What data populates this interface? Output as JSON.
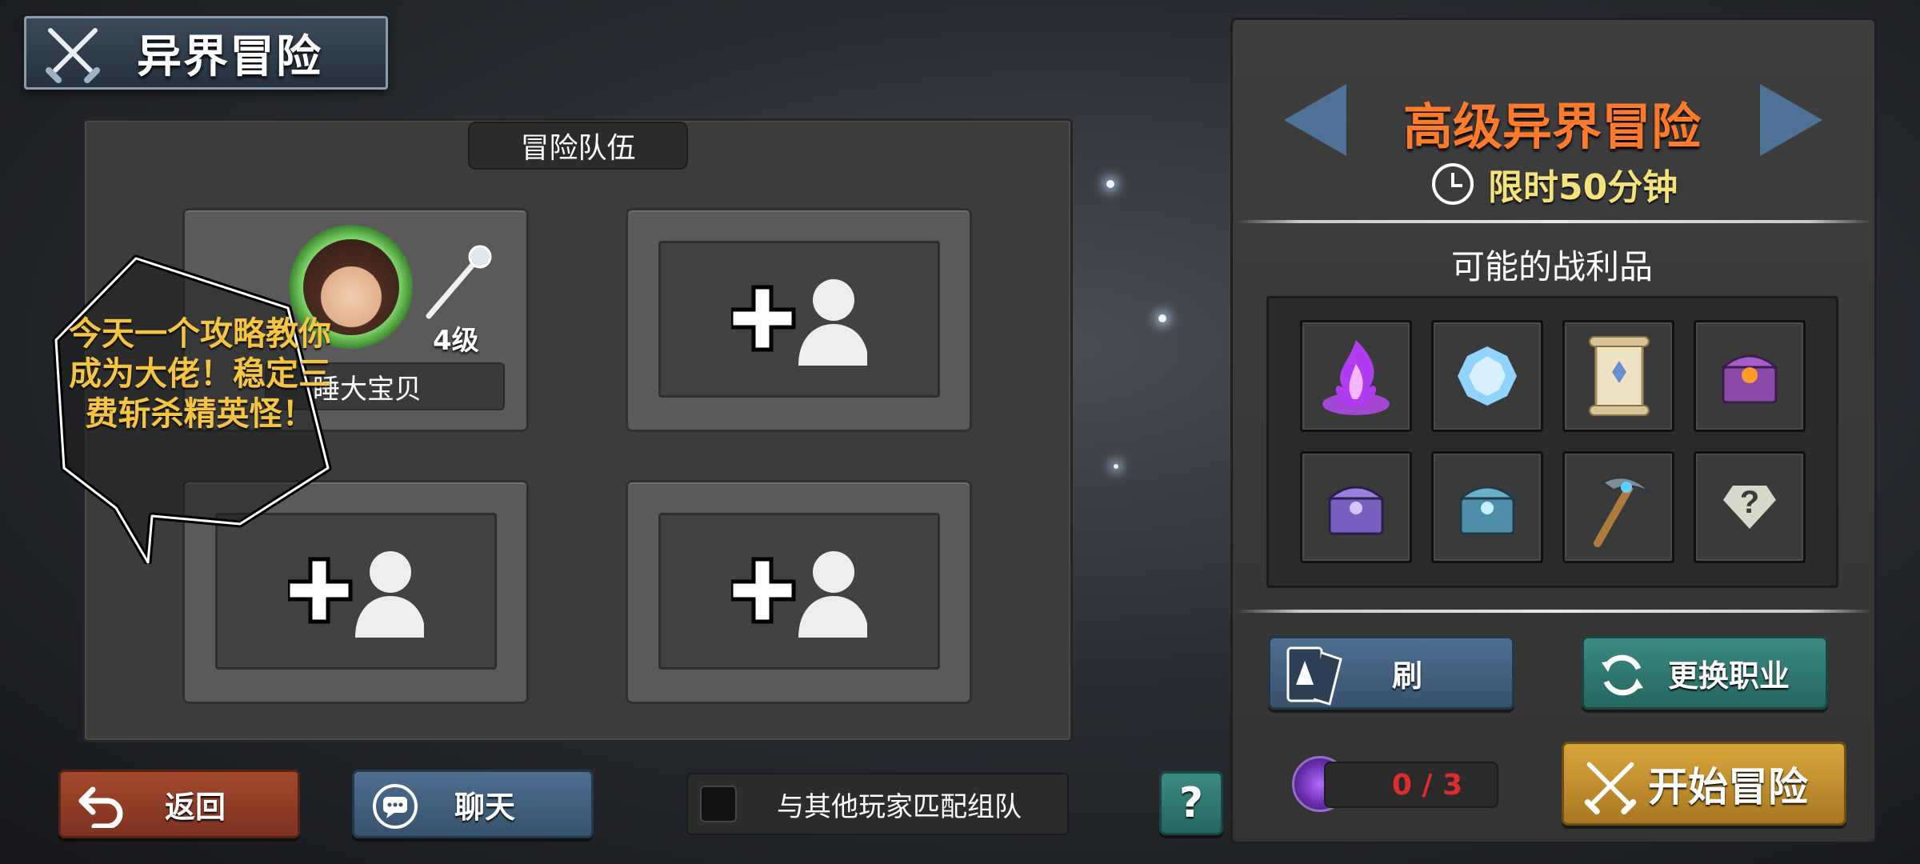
{
  "header": {
    "title": "异界冒险",
    "icon": "crossed-swords-icon"
  },
  "team": {
    "tab_label": "冒险队伍",
    "slots": [
      {
        "filled": true,
        "level": "4级",
        "name": "睡大宝贝",
        "weapon_icon": "staff-icon"
      },
      {
        "filled": false,
        "icon": "add-member-icon"
      },
      {
        "filled": false,
        "icon": "add-member-icon"
      },
      {
        "filled": false,
        "icon": "add-member-icon"
      }
    ]
  },
  "overlay": {
    "bubble_text": "今天一个攻略教你成为大佬！稳定三费斩杀精英怪！"
  },
  "bottom_bar": {
    "back_label": "返回",
    "chat_label": "聊天",
    "match_label": "与其他玩家匹配组队",
    "help_label": "?"
  },
  "mode": {
    "title": "高级异界冒险",
    "time_limit": "限时50分钟",
    "loot_title": "可能的战利品",
    "loot_items": [
      "purple-flame-icon",
      "ice-crystal-icon",
      "scroll-icon",
      "orange-chest-icon",
      "purple-chest-icon",
      "blue-chest-icon",
      "pickaxe-icon",
      "unknown-reward-icon"
    ]
  },
  "actions": {
    "refresh_label": "刷",
    "change_class_label": "更换职业",
    "counter": "0 / 3",
    "start_label": "开始冒险"
  },
  "colors": {
    "mode_title": "#ff7a2a",
    "time_limit": "#f5e27a",
    "counter": "#e02c2c",
    "bubble_text": "#f5c542",
    "start_button": "#d9a63c"
  }
}
